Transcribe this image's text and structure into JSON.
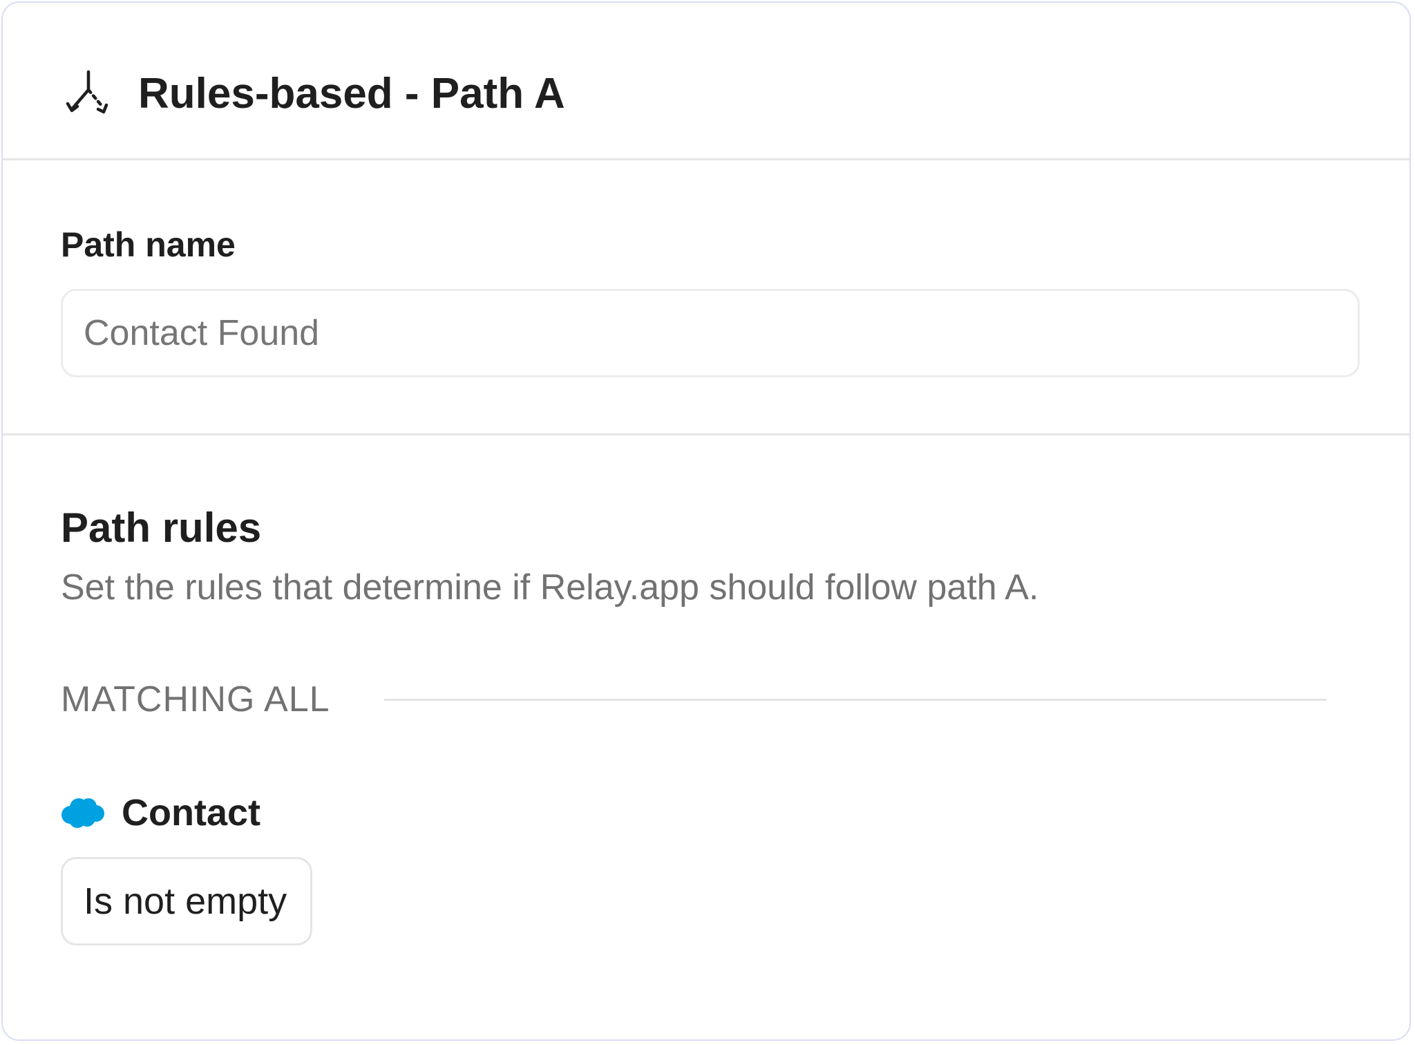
{
  "header": {
    "title": "Rules-based - Path A",
    "icon": "branch-split-icon"
  },
  "path_name": {
    "label": "Path name",
    "placeholder": "Contact Found",
    "value": ""
  },
  "path_rules": {
    "title": "Path rules",
    "description": "Set the rules that determine if Relay.app should follow path A.",
    "matching_label": "MATCHING ALL",
    "rules": [
      {
        "field_icon": "salesforce-icon",
        "field_name": "Contact",
        "condition": "Is not empty"
      }
    ]
  },
  "colors": {
    "panel_border": "#d9ddf5",
    "divider": "#e6e6e6",
    "text_primary": "#1f1f1f",
    "text_secondary": "#727272",
    "salesforce_blue": "#00a1e0"
  }
}
